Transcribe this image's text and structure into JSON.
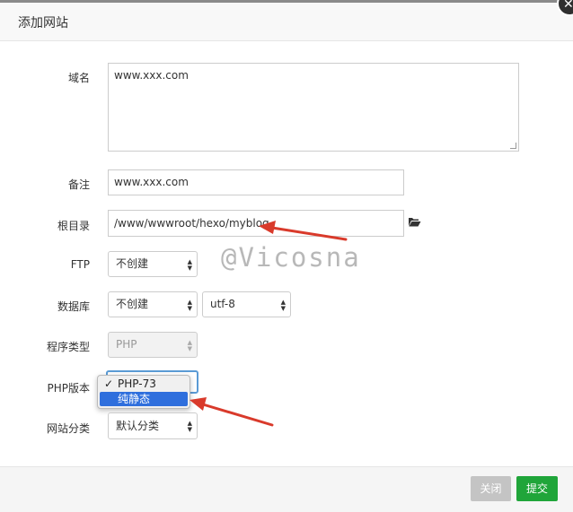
{
  "dialog": {
    "title": "添加网站"
  },
  "form": {
    "domain": {
      "label": "域名",
      "value": "www.xxx.com"
    },
    "remark": {
      "label": "备注",
      "value": "www.xxx.com"
    },
    "root": {
      "label": "根目录",
      "value": "/www/wwwroot/hexo/myblog"
    },
    "ftp": {
      "label": "FTP",
      "value": "不创建"
    },
    "database": {
      "label": "数据库",
      "value": "不创建",
      "charset": "utf-8"
    },
    "program_type": {
      "label": "程序类型",
      "value": "PHP"
    },
    "php_version": {
      "label": "PHP版本",
      "options": [
        "PHP-73",
        "纯静态"
      ],
      "selected": "PHP-73",
      "highlighted": "纯静态"
    },
    "site_category": {
      "label": "网站分类",
      "value": "默认分类"
    }
  },
  "watermark": "@Vicosna",
  "footer": {
    "close_label": "关闭",
    "submit_label": "提交"
  },
  "colors": {
    "submit": "#20a53a",
    "close": "#c4c4c4",
    "highlight": "#2f6fdd",
    "annotation_arrow": "#d93a2b"
  },
  "icons": {
    "folder": "folder-open-icon",
    "close": "close-icon",
    "check": "check-icon"
  }
}
